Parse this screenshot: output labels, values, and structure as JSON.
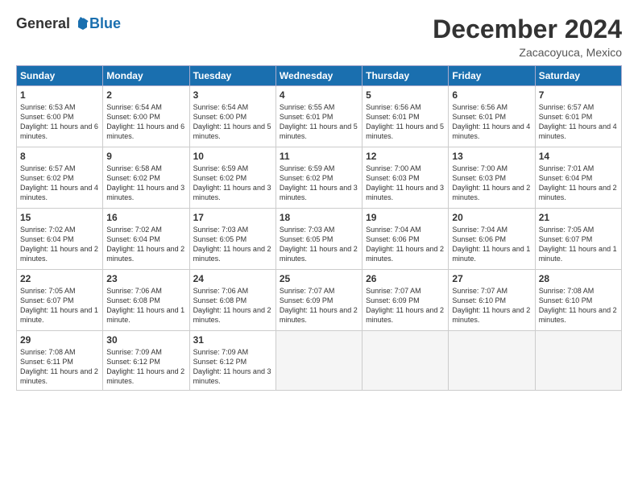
{
  "logo": {
    "general": "General",
    "blue": "Blue"
  },
  "header": {
    "month": "December 2024",
    "location": "Zacacoyuca, Mexico"
  },
  "weekdays": [
    "Sunday",
    "Monday",
    "Tuesday",
    "Wednesday",
    "Thursday",
    "Friday",
    "Saturday"
  ],
  "weeks": [
    [
      {
        "day": "1",
        "sunrise": "Sunrise: 6:53 AM",
        "sunset": "Sunset: 6:00 PM",
        "daylight": "Daylight: 11 hours and 6 minutes."
      },
      {
        "day": "2",
        "sunrise": "Sunrise: 6:54 AM",
        "sunset": "Sunset: 6:00 PM",
        "daylight": "Daylight: 11 hours and 6 minutes."
      },
      {
        "day": "3",
        "sunrise": "Sunrise: 6:54 AM",
        "sunset": "Sunset: 6:00 PM",
        "daylight": "Daylight: 11 hours and 5 minutes."
      },
      {
        "day": "4",
        "sunrise": "Sunrise: 6:55 AM",
        "sunset": "Sunset: 6:01 PM",
        "daylight": "Daylight: 11 hours and 5 minutes."
      },
      {
        "day": "5",
        "sunrise": "Sunrise: 6:56 AM",
        "sunset": "Sunset: 6:01 PM",
        "daylight": "Daylight: 11 hours and 5 minutes."
      },
      {
        "day": "6",
        "sunrise": "Sunrise: 6:56 AM",
        "sunset": "Sunset: 6:01 PM",
        "daylight": "Daylight: 11 hours and 4 minutes."
      },
      {
        "day": "7",
        "sunrise": "Sunrise: 6:57 AM",
        "sunset": "Sunset: 6:01 PM",
        "daylight": "Daylight: 11 hours and 4 minutes."
      }
    ],
    [
      {
        "day": "8",
        "sunrise": "Sunrise: 6:57 AM",
        "sunset": "Sunset: 6:02 PM",
        "daylight": "Daylight: 11 hours and 4 minutes."
      },
      {
        "day": "9",
        "sunrise": "Sunrise: 6:58 AM",
        "sunset": "Sunset: 6:02 PM",
        "daylight": "Daylight: 11 hours and 3 minutes."
      },
      {
        "day": "10",
        "sunrise": "Sunrise: 6:59 AM",
        "sunset": "Sunset: 6:02 PM",
        "daylight": "Daylight: 11 hours and 3 minutes."
      },
      {
        "day": "11",
        "sunrise": "Sunrise: 6:59 AM",
        "sunset": "Sunset: 6:02 PM",
        "daylight": "Daylight: 11 hours and 3 minutes."
      },
      {
        "day": "12",
        "sunrise": "Sunrise: 7:00 AM",
        "sunset": "Sunset: 6:03 PM",
        "daylight": "Daylight: 11 hours and 3 minutes."
      },
      {
        "day": "13",
        "sunrise": "Sunrise: 7:00 AM",
        "sunset": "Sunset: 6:03 PM",
        "daylight": "Daylight: 11 hours and 2 minutes."
      },
      {
        "day": "14",
        "sunrise": "Sunrise: 7:01 AM",
        "sunset": "Sunset: 6:04 PM",
        "daylight": "Daylight: 11 hours and 2 minutes."
      }
    ],
    [
      {
        "day": "15",
        "sunrise": "Sunrise: 7:02 AM",
        "sunset": "Sunset: 6:04 PM",
        "daylight": "Daylight: 11 hours and 2 minutes."
      },
      {
        "day": "16",
        "sunrise": "Sunrise: 7:02 AM",
        "sunset": "Sunset: 6:04 PM",
        "daylight": "Daylight: 11 hours and 2 minutes."
      },
      {
        "day": "17",
        "sunrise": "Sunrise: 7:03 AM",
        "sunset": "Sunset: 6:05 PM",
        "daylight": "Daylight: 11 hours and 2 minutes."
      },
      {
        "day": "18",
        "sunrise": "Sunrise: 7:03 AM",
        "sunset": "Sunset: 6:05 PM",
        "daylight": "Daylight: 11 hours and 2 minutes."
      },
      {
        "day": "19",
        "sunrise": "Sunrise: 7:04 AM",
        "sunset": "Sunset: 6:06 PM",
        "daylight": "Daylight: 11 hours and 2 minutes."
      },
      {
        "day": "20",
        "sunrise": "Sunrise: 7:04 AM",
        "sunset": "Sunset: 6:06 PM",
        "daylight": "Daylight: 11 hours and 1 minute."
      },
      {
        "day": "21",
        "sunrise": "Sunrise: 7:05 AM",
        "sunset": "Sunset: 6:07 PM",
        "daylight": "Daylight: 11 hours and 1 minute."
      }
    ],
    [
      {
        "day": "22",
        "sunrise": "Sunrise: 7:05 AM",
        "sunset": "Sunset: 6:07 PM",
        "daylight": "Daylight: 11 hours and 1 minute."
      },
      {
        "day": "23",
        "sunrise": "Sunrise: 7:06 AM",
        "sunset": "Sunset: 6:08 PM",
        "daylight": "Daylight: 11 hours and 1 minute."
      },
      {
        "day": "24",
        "sunrise": "Sunrise: 7:06 AM",
        "sunset": "Sunset: 6:08 PM",
        "daylight": "Daylight: 11 hours and 2 minutes."
      },
      {
        "day": "25",
        "sunrise": "Sunrise: 7:07 AM",
        "sunset": "Sunset: 6:09 PM",
        "daylight": "Daylight: 11 hours and 2 minutes."
      },
      {
        "day": "26",
        "sunrise": "Sunrise: 7:07 AM",
        "sunset": "Sunset: 6:09 PM",
        "daylight": "Daylight: 11 hours and 2 minutes."
      },
      {
        "day": "27",
        "sunrise": "Sunrise: 7:07 AM",
        "sunset": "Sunset: 6:10 PM",
        "daylight": "Daylight: 11 hours and 2 minutes."
      },
      {
        "day": "28",
        "sunrise": "Sunrise: 7:08 AM",
        "sunset": "Sunset: 6:10 PM",
        "daylight": "Daylight: 11 hours and 2 minutes."
      }
    ],
    [
      {
        "day": "29",
        "sunrise": "Sunrise: 7:08 AM",
        "sunset": "Sunset: 6:11 PM",
        "daylight": "Daylight: 11 hours and 2 minutes."
      },
      {
        "day": "30",
        "sunrise": "Sunrise: 7:09 AM",
        "sunset": "Sunset: 6:12 PM",
        "daylight": "Daylight: 11 hours and 2 minutes."
      },
      {
        "day": "31",
        "sunrise": "Sunrise: 7:09 AM",
        "sunset": "Sunset: 6:12 PM",
        "daylight": "Daylight: 11 hours and 3 minutes."
      },
      null,
      null,
      null,
      null
    ]
  ]
}
